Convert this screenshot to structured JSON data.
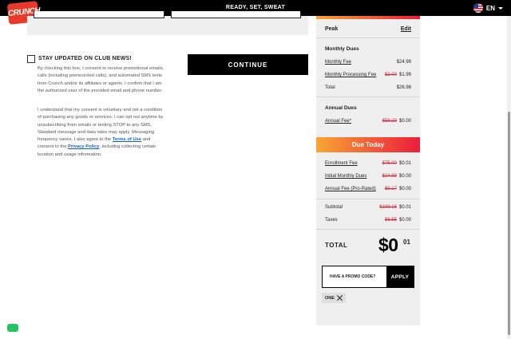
{
  "header": {
    "logo_text": "CRUNCH",
    "tagline": "READY, SET, SWEAT",
    "language": "EN"
  },
  "optin": {
    "title": "STAY UPDATED ON CLUB NEWS!",
    "consent_1": "By checking this box, I consent to receive promotional emails, calls (including prerecorded calls), and automated SMS texts from Crunch and/or its affiliates or agents. I confirm that I am the authorized user of the provided email and phone number.",
    "consent_2_a": "I understand that my consent is voluntary and not a condition of purchasing any goods or services. I can opt out anytime by unsubscribing from emails or texting STOP to any SMS. Standard message and data rates may apply. Messaging frequency varies. I also agree to the ",
    "terms_link": "Terms of Use",
    "consent_2_b": " and consent to the ",
    "privacy_link": "Privacy Policy",
    "consent_2_c": ", including collecting certain location and usage information."
  },
  "continue_label": "CONTINUE",
  "summary": {
    "plan_name": "Peak",
    "edit_label": "Edit",
    "monthly_title": "Monthly Dues",
    "monthly_fee_label": "Monthly Fee",
    "monthly_fee_value": "$24.99",
    "processing_label": "Monthly Processing Fee",
    "processing_old": "$2.00",
    "processing_new": "$1.99",
    "monthly_total_label": "Total",
    "monthly_total_value": "$26.98",
    "annual_title": "Annual Dues",
    "annual_fee_label": "Annual Fee*",
    "annual_old": "$58.29",
    "annual_new": "$0.00",
    "due_today_title": "Due Today",
    "enroll_label": "Enrollment Fee",
    "enroll_old": "$75.00",
    "enroll_new": "$0.01",
    "initial_label": "Initial Monthly Dues",
    "initial_old": "$24.99",
    "initial_new": "$0.00",
    "prorated_label": "Annual Fee (Pro-Rated)",
    "prorated_old": "$9.17",
    "prorated_new": "$0.00",
    "subtotal_label": "Subtotal",
    "subtotal_old": "$109.16",
    "subtotal_new": "$0.01",
    "taxes_label": "Taxes",
    "taxes_old": "$6.55",
    "taxes_new": "$0.00",
    "total_label": "TOTAL",
    "total_dollars": "$0",
    "total_cents": "01"
  },
  "promo": {
    "placeholder": "HAVE A PROMO CODE?",
    "apply_label": "APPLY",
    "applied_code": "ONE"
  },
  "colors": {
    "gradient_start": "#f7a634",
    "gradient_end": "#ec1c3a",
    "strike": "#d0283b",
    "link": "#1a5fd1",
    "chat": "#22c55e"
  }
}
